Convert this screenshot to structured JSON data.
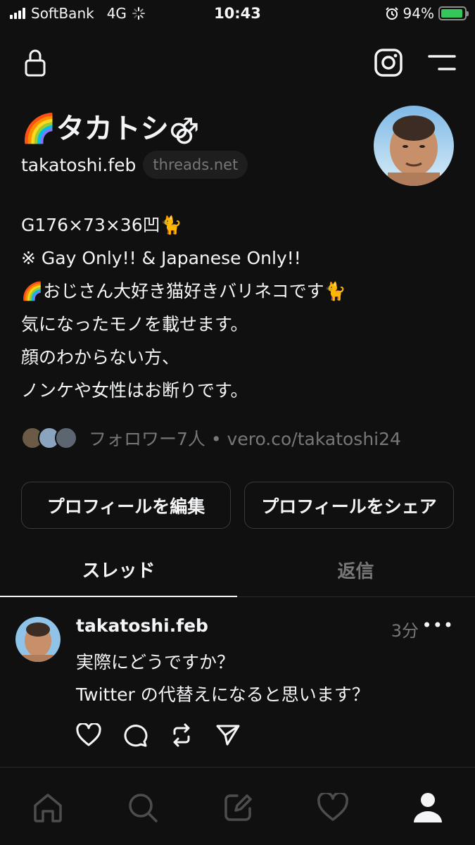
{
  "status_bar": {
    "carrier": "SoftBank",
    "network": "4G",
    "time": "10:43",
    "battery": "94%",
    "battery_level": 0.94
  },
  "header": {
    "lock_icon": "lock-icon",
    "instagram_icon": "instagram-icon",
    "menu_icon": "menu-icon"
  },
  "profile": {
    "name": "🌈タカトシ⚣",
    "handle": "takatoshi.feb",
    "domain_chip": "threads.net",
    "bio": [
      "G176×73×36凹🐈",
      "※ Gay Only!! & Japanese Only!!",
      "🌈おじさん大好き猫好きバリネコです🐈",
      "気になったモノを載せます。",
      "顔のわからない方、",
      "ノンケや女性はお断りです。"
    ],
    "followers_text": "フォロワー7人 • vero.co/takatoshi24"
  },
  "buttons": {
    "edit": "プロフィールを編集",
    "share": "プロフィールをシェア"
  },
  "tabs": {
    "threads": "スレッド",
    "replies": "返信"
  },
  "post": {
    "username": "takatoshi.feb",
    "time": "3分",
    "more": "•••",
    "line1": "実際にどうですか？",
    "line2": "Twitter の代替えになると思います？"
  },
  "colors": {
    "background": "#101010",
    "text": "#f3f5f7",
    "muted": "#777777",
    "border": "#3a3a3a",
    "battery": "#34c759"
  }
}
